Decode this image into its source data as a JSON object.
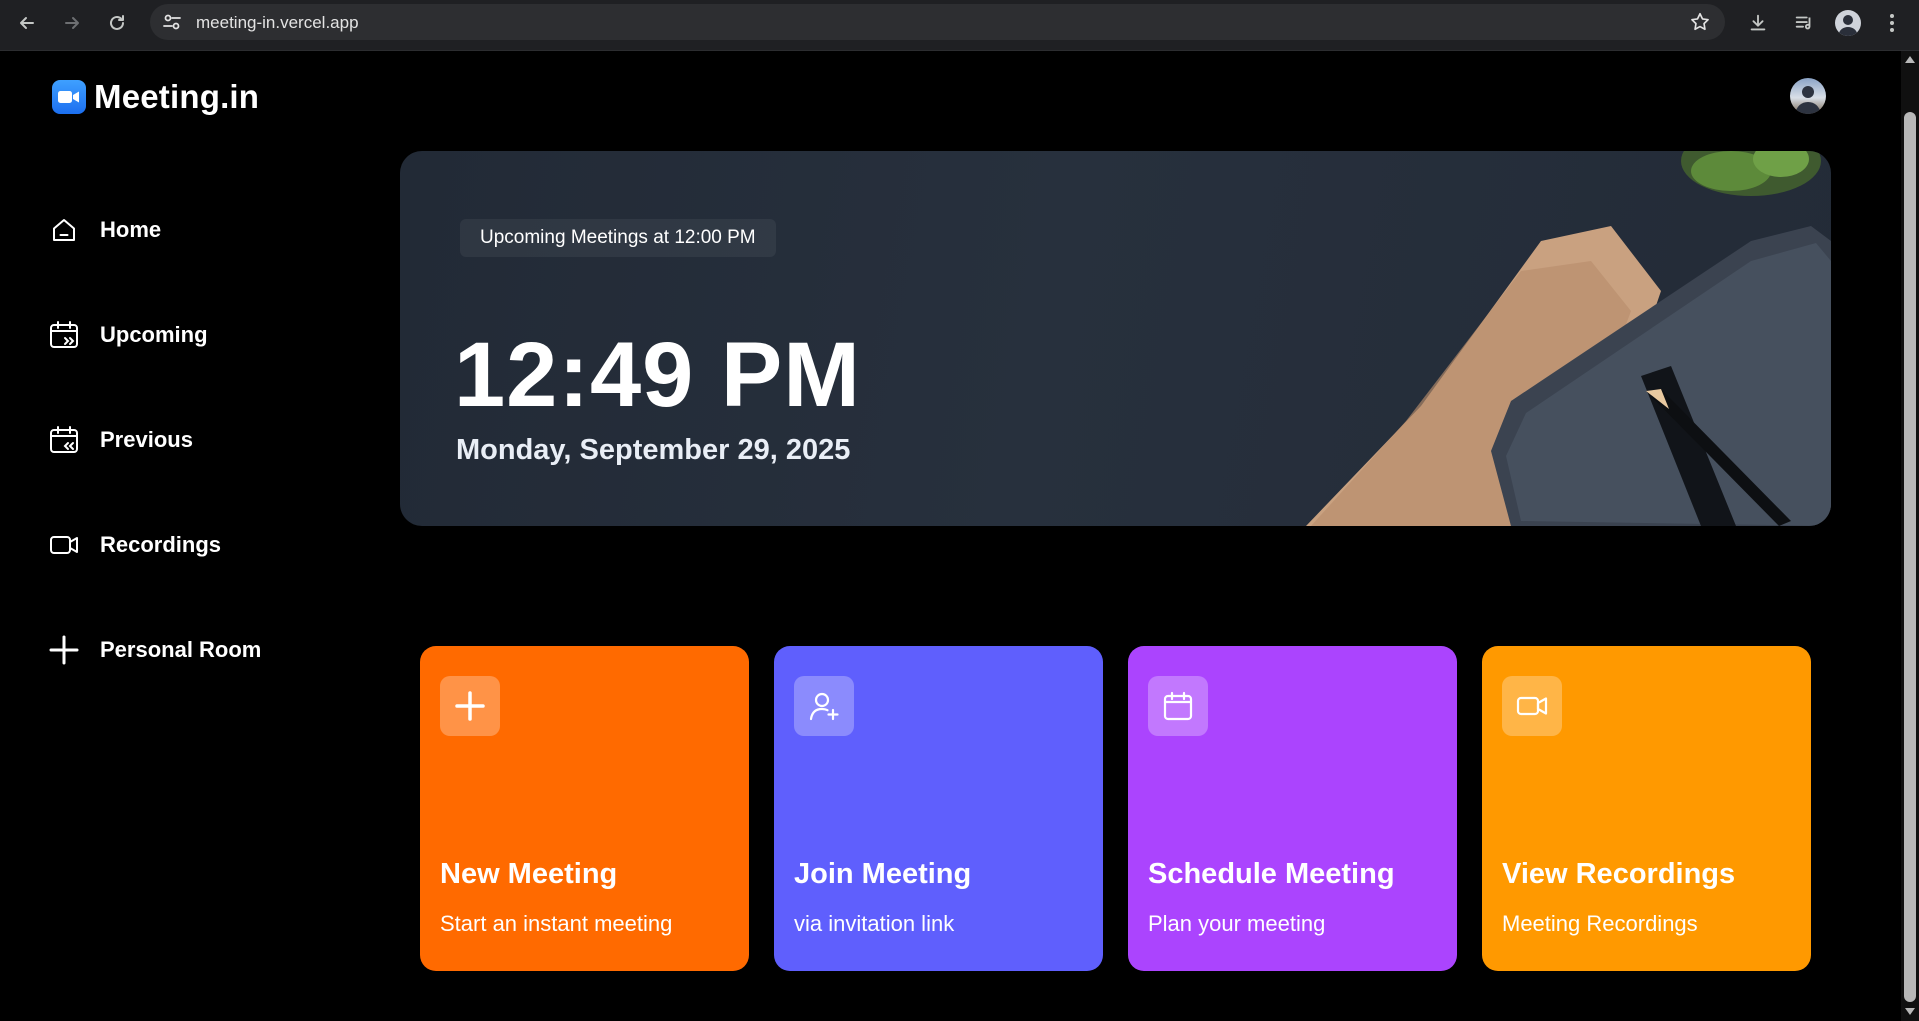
{
  "browser": {
    "url": "meeting-in.vercel.app"
  },
  "app": {
    "name": "Meeting.in"
  },
  "sidebar": {
    "items": [
      {
        "label": "Home",
        "icon": "home-icon"
      },
      {
        "label": "Upcoming",
        "icon": "calendar-upcoming-icon"
      },
      {
        "label": "Previous",
        "icon": "calendar-previous-icon"
      },
      {
        "label": "Recordings",
        "icon": "video-icon"
      },
      {
        "label": "Personal Room",
        "icon": "plus-icon"
      }
    ]
  },
  "hero": {
    "upcoming_label": "Upcoming Meetings at 12:00 PM",
    "time": "12:49 PM",
    "date": "Monday, September 29, 2025"
  },
  "cards": [
    {
      "title": "New Meeting",
      "subtitle": "Start an instant meeting",
      "color": "#ff6a00",
      "icon": "plus-icon"
    },
    {
      "title": "Join Meeting",
      "subtitle": "via invitation link",
      "color": "#5f5ffd",
      "icon": "user-add-icon"
    },
    {
      "title": "Schedule Meeting",
      "subtitle": "Plan your meeting",
      "color": "#ab44fe",
      "icon": "calendar-icon"
    },
    {
      "title": "View Recordings",
      "subtitle": "Meeting Recordings",
      "color": "#ff9900",
      "icon": "video-icon"
    }
  ]
}
